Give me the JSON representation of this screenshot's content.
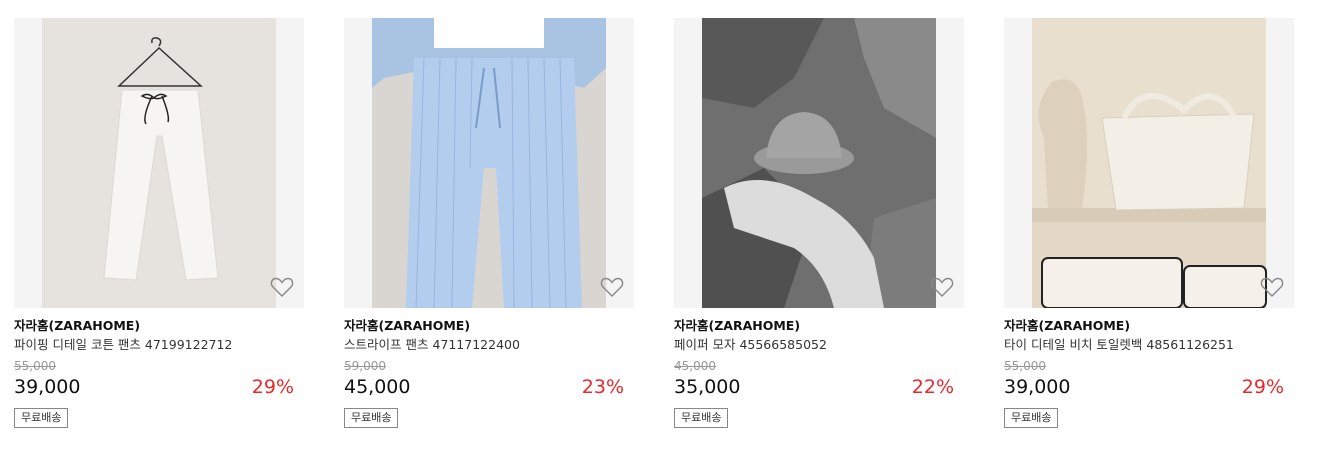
{
  "products": [
    {
      "brand": "자라홈(ZARAHOME)",
      "name": "파이핑 디테일 코튼 팬츠 47199122712",
      "original_price": "55,000",
      "price": "39,000",
      "discount": "29%",
      "badge": "무료배송",
      "image_desc": "white cotton pants on hanger",
      "wishlist_icon": "heart-outline-icon"
    },
    {
      "brand": "자라홈(ZARAHOME)",
      "name": "스트라이프 팬츠 47117122400",
      "original_price": "59,000",
      "price": "45,000",
      "discount": "23%",
      "badge": "무료배송",
      "image_desc": "blue striped pajama pants on model",
      "wishlist_icon": "heart-outline-icon"
    },
    {
      "brand": "자라홈(ZARAHOME)",
      "name": "페이퍼 모자 45566585052",
      "original_price": "45,000",
      "price": "35,000",
      "discount": "22%",
      "badge": "무료배송",
      "image_desc": "crochet bucket hat and towel on rocks",
      "wishlist_icon": "heart-outline-icon"
    },
    {
      "brand": "자라홈(ZARAHOME)",
      "name": "타이 디테일 비치 토일렛백 48561126251",
      "original_price": "55,000",
      "price": "39,000",
      "discount": "29%",
      "badge": "무료배송",
      "image_desc": "cream tote bag and pouch on shelf",
      "wishlist_icon": "heart-outline-icon"
    }
  ],
  "colors": {
    "discount": "#e8282b",
    "strike": "#999999",
    "text": "#111111"
  }
}
